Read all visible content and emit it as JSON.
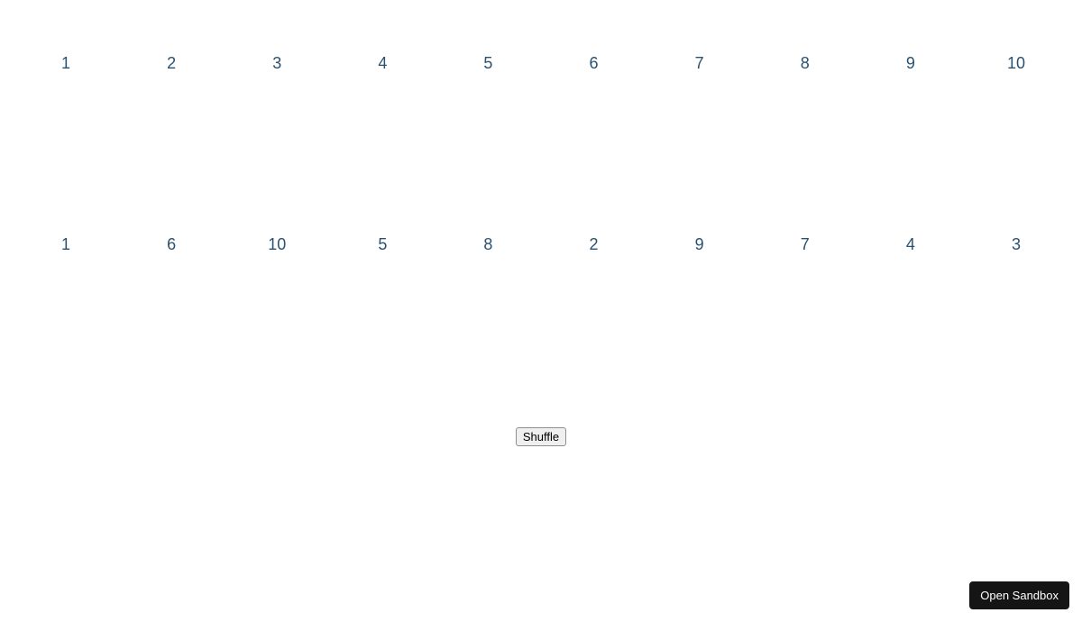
{
  "rows": {
    "ordered": [
      "1",
      "2",
      "3",
      "4",
      "5",
      "6",
      "7",
      "8",
      "9",
      "10"
    ],
    "shuffled": [
      "1",
      "6",
      "10",
      "5",
      "8",
      "2",
      "9",
      "7",
      "4",
      "3"
    ]
  },
  "controls": {
    "shuffle_label": "Shuffle"
  },
  "footer": {
    "open_sandbox_label": "Open Sandbox"
  },
  "colors": {
    "number_color": "#2a516f",
    "button_bg": "#efefef",
    "sandbox_bg": "#151515"
  }
}
